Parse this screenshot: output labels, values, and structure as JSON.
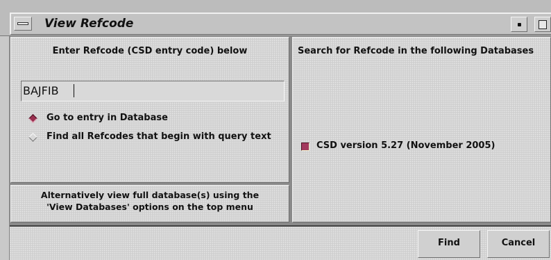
{
  "window": {
    "title": "View Refcode"
  },
  "left_panel": {
    "heading": "Enter Refcode (CSD entry code) below",
    "refcode_value": "BAJFIB",
    "radio_options": [
      {
        "label": "Go to entry in Database",
        "selected": true
      },
      {
        "label": "Find all Refcodes that begin with query text",
        "selected": false
      }
    ],
    "note_line1": "Alternatively view full database(s) using the",
    "note_line2": "'View Databases' options on the top menu"
  },
  "right_panel": {
    "heading": "Search for Refcode in the following Databases",
    "databases": [
      {
        "label": "CSD version 5.27 (November 2005)",
        "checked": true
      }
    ]
  },
  "buttons": {
    "find": "Find",
    "cancel": "Cancel"
  },
  "colors": {
    "accent": "#a33a5e",
    "panel": "#d6d6d6"
  },
  "icons": {
    "window_menu": "window-menu-icon",
    "minimize": "minimize-icon",
    "maximize": "maximize-icon"
  }
}
